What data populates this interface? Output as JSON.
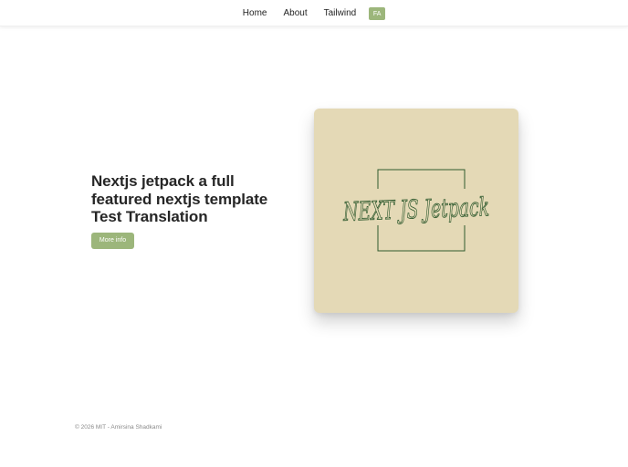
{
  "header": {
    "nav": [
      {
        "label": "Home"
      },
      {
        "label": "About"
      },
      {
        "label": "Tailwind"
      }
    ],
    "lang_button": "FA"
  },
  "hero": {
    "title_lines": [
      "Nextjs jetpack a full",
      "featured nextjs template",
      "Test Translation"
    ],
    "button_label": "More info"
  },
  "logo": {
    "text": "NEXT JS Jetpack",
    "card_color": "#e4d9b6",
    "ink_color": "#2f5a2e"
  },
  "footer": {
    "text": "© 2026 MIT - Amirsina Shadkami"
  },
  "colors": {
    "accent": "#9cb67b",
    "text": "#262626"
  }
}
